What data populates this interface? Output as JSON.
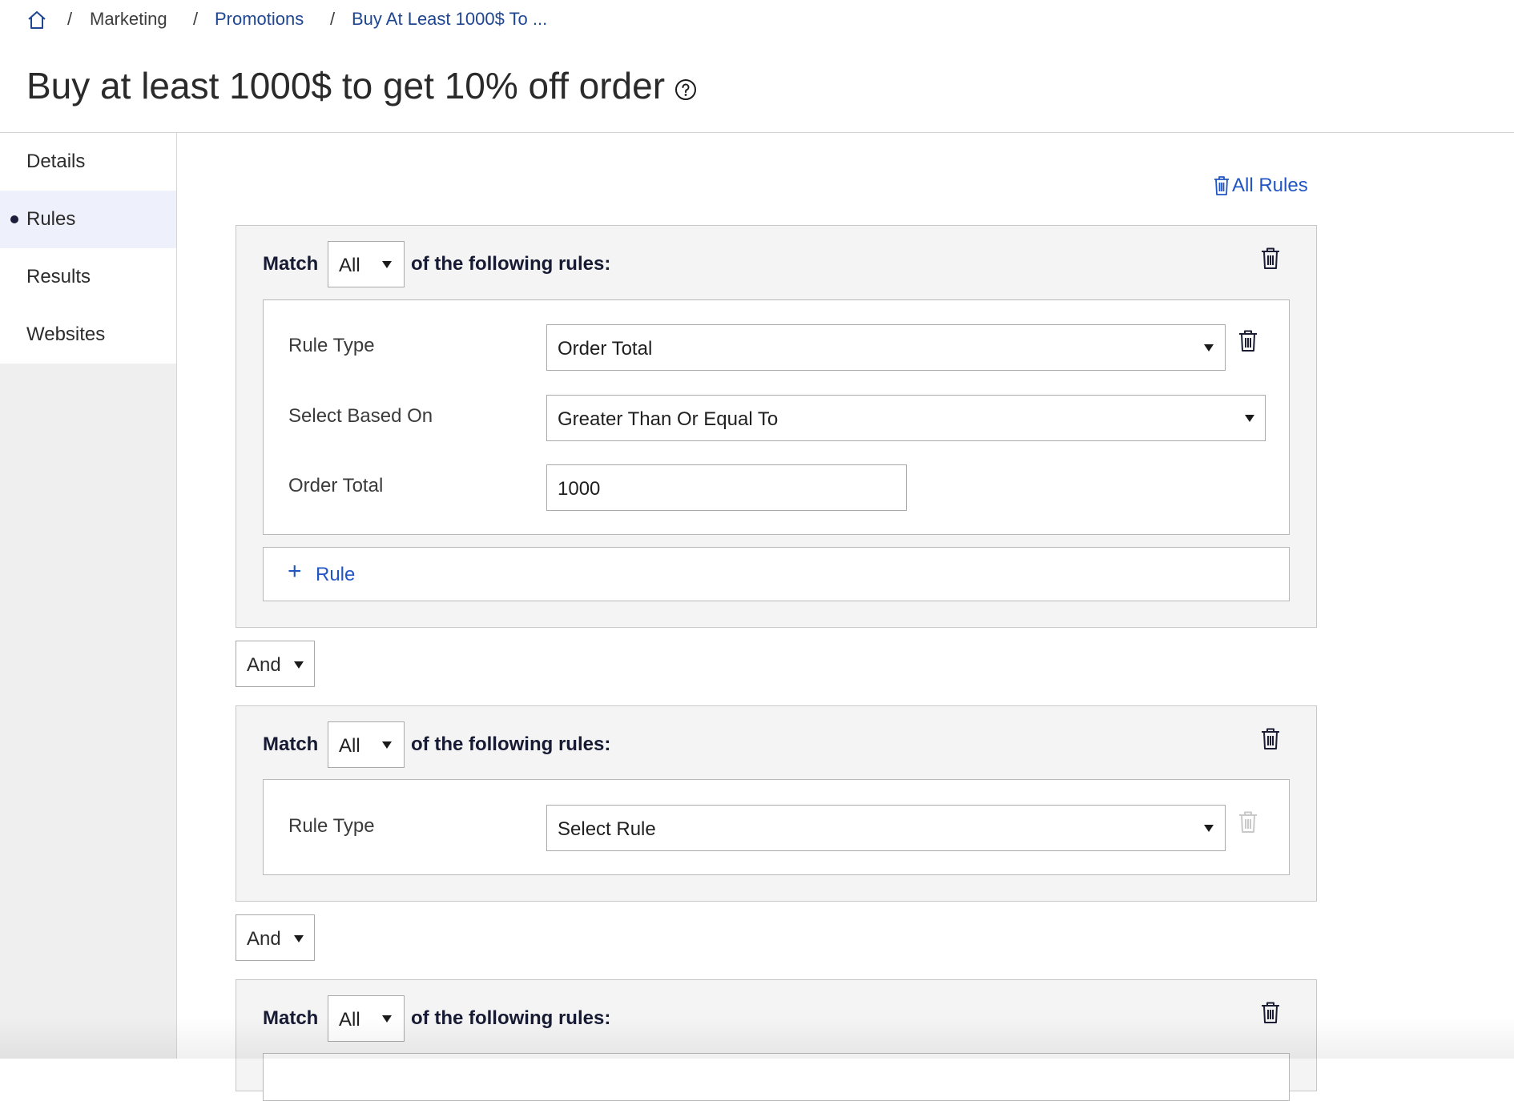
{
  "breadcrumb": {
    "home_icon": "home-icon",
    "separator": "/",
    "items": [
      "Marketing",
      "Promotions",
      "Buy At Least 1000$ To ..."
    ]
  },
  "page": {
    "title": "Buy at least 1000$ to get 10% off order",
    "help_icon": "help-circle-icon"
  },
  "sidebar": {
    "items": [
      {
        "label": "Details",
        "active": false
      },
      {
        "label": "Rules",
        "active": true
      },
      {
        "label": "Results",
        "active": false
      },
      {
        "label": "Websites",
        "active": false
      }
    ]
  },
  "rules": {
    "clear_all_label": "All Rules",
    "clear_all_icon": "trash-icon",
    "groups": [
      {
        "match_label": "Match",
        "match_value": "All",
        "following_label": "of the following rules:",
        "rule_type_label": "Rule Type",
        "rule_type_value": "Order Total",
        "based_on_label": "Select Based On",
        "based_on_value": "Greater Than Or Equal To",
        "order_total_label": "Order Total",
        "order_total_value": "1000",
        "add_rule_label": "Rule"
      },
      {
        "match_label": "Match",
        "match_value": "All",
        "following_label": "of the following rules:",
        "rule_type_label": "Rule Type",
        "rule_type_value": "Select Rule"
      },
      {
        "match_label": "Match",
        "match_value": "All",
        "following_label": "of the following rules:"
      }
    ],
    "connectors": [
      "And",
      "And"
    ]
  },
  "colors": {
    "link": "#2255c4",
    "breadcrumb_link": "#1f4690",
    "active_nav_bg": "#eef0fb",
    "group_bg": "#f4f4f4",
    "disabled_icon": "#c9c9c9"
  }
}
